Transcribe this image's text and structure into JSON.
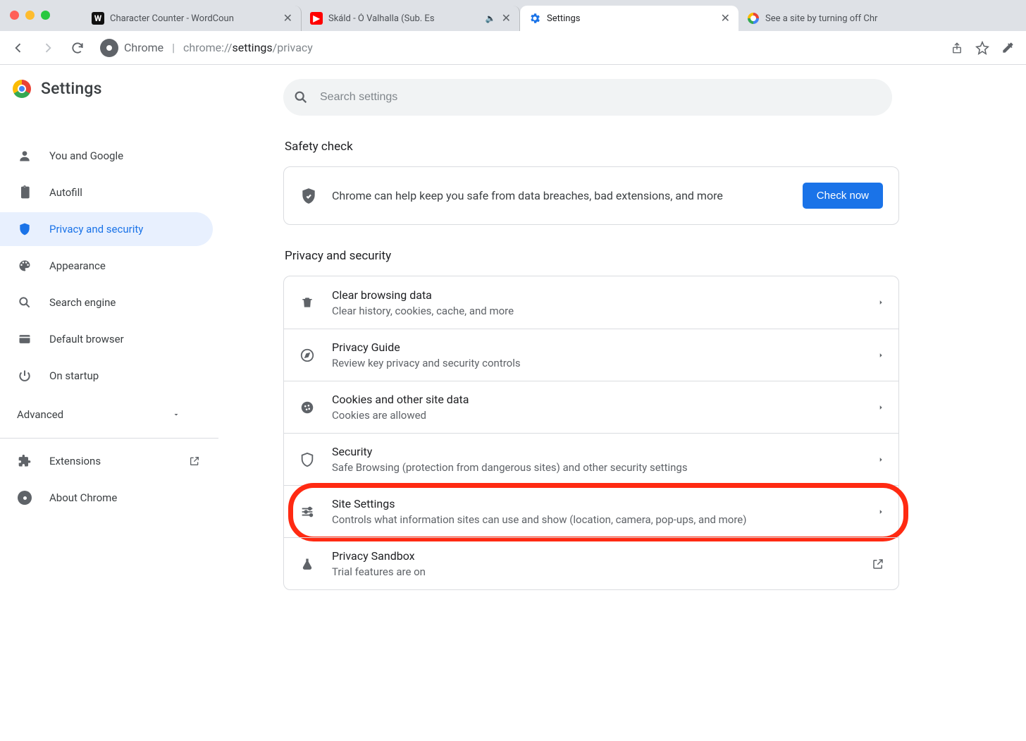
{
  "browser": {
    "tabs": [
      {
        "title": "Character Counter - WordCoun"
      },
      {
        "title": "Skáld - Ó Valhalla (Sub. Es"
      },
      {
        "title": "Settings"
      },
      {
        "title": "See a site by turning off Chr"
      }
    ],
    "url_prefix": "chrome://",
    "url_mid": "settings",
    "url_suffix": "/privacy",
    "site_label": "Chrome"
  },
  "header": {
    "title": "Settings"
  },
  "search": {
    "placeholder": "Search settings"
  },
  "sidebar": {
    "items": [
      {
        "label": "You and Google"
      },
      {
        "label": "Autofill"
      },
      {
        "label": "Privacy and security"
      },
      {
        "label": "Appearance"
      },
      {
        "label": "Search engine"
      },
      {
        "label": "Default browser"
      },
      {
        "label": "On startup"
      }
    ],
    "advanced_label": "Advanced",
    "extensions_label": "Extensions",
    "about_label": "About Chrome"
  },
  "sections": {
    "safety": {
      "title": "Safety check",
      "text": "Chrome can help keep you safe from data breaches, bad extensions, and more",
      "button": "Check now"
    },
    "privacy": {
      "title": "Privacy and security",
      "rows": [
        {
          "title": "Clear browsing data",
          "sub": "Clear history, cookies, cache, and more"
        },
        {
          "title": "Privacy Guide",
          "sub": "Review key privacy and security controls"
        },
        {
          "title": "Cookies and other site data",
          "sub": "Cookies are allowed"
        },
        {
          "title": "Security",
          "sub": "Safe Browsing (protection from dangerous sites) and other security settings"
        },
        {
          "title": "Site Settings",
          "sub": "Controls what information sites can use and show (location, camera, pop-ups, and more)"
        },
        {
          "title": "Privacy Sandbox",
          "sub": "Trial features are on"
        }
      ]
    }
  }
}
